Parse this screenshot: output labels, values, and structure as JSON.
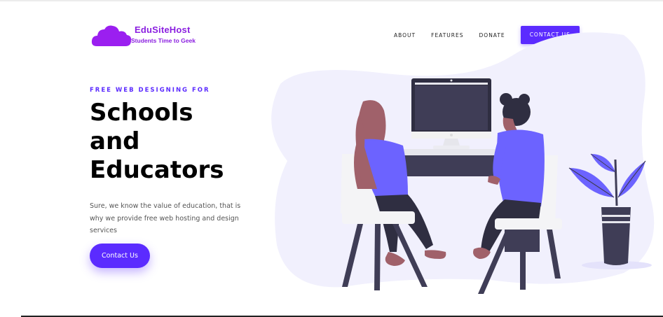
{
  "brand": {
    "name": "EduSiteHost",
    "tagline": "Students Time to Geek",
    "color": "#8a1ee0"
  },
  "nav": {
    "items": [
      "ABOUT",
      "FEATURES",
      "DONATE"
    ],
    "cta": "CONTACT US"
  },
  "hero": {
    "eyebrow": "FREE WEB DESIGNING FOR",
    "title_lines": [
      "Schools",
      "and",
      "Educators"
    ],
    "description": "Sure, we know the value of education, that is why we provide free web hosting and design services",
    "button": "Contact Us"
  },
  "colors": {
    "accent": "#5b2bff",
    "blob": "#f1f0fd"
  }
}
